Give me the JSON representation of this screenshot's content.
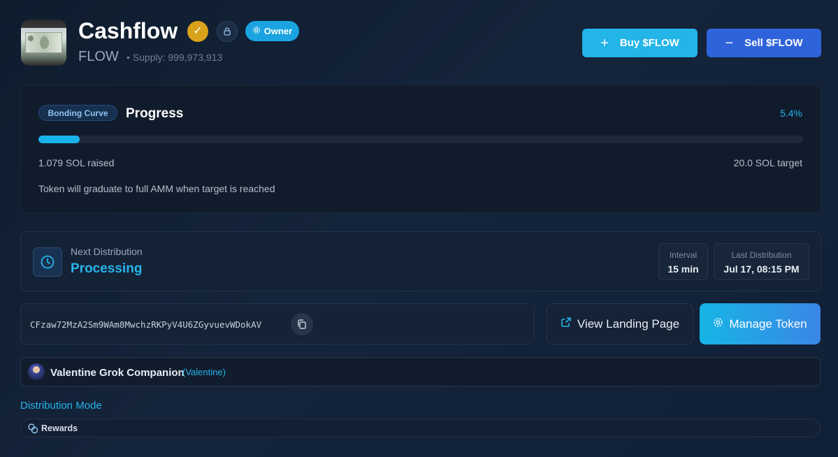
{
  "token": {
    "name": "Cashflow",
    "ticker": "FLOW",
    "supply": "• Supply: 999,973,913",
    "owner_badge": "Owner"
  },
  "actions": {
    "buy_label": "Buy $FLOW",
    "sell_label": "Sell $FLOW"
  },
  "progress": {
    "chip": "Bonding Curve",
    "title": "Progress",
    "percent_label": "5.4%",
    "percent_value": 5.4,
    "raised": "1.079 SOL raised",
    "target": "20.0 SOL target",
    "note": "Token will graduate to full AMM when target is reached"
  },
  "distribution": {
    "label": "Next Distribution",
    "status": "Processing",
    "interval_label": "Interval",
    "interval_value": "15 min",
    "last_label": "Last Distribution",
    "last_value": "Jul 17, 08:15 PM"
  },
  "contract": {
    "address": "CFzaw72MzA2Sm9WAm8MwchzRKPyV4U6ZGyvuevWDokAV"
  },
  "links": {
    "landing_label": "View Landing Page",
    "manage_label": "Manage Token"
  },
  "persona": {
    "name": "Valentine Grok Companion",
    "tag": "(Valentine)"
  },
  "distribution_mode": {
    "title": "Distribution Mode",
    "value": "Rewards"
  },
  "colors": {
    "accent": "#27b4ea",
    "buy": "#23b4e8",
    "sell": "#2f63db",
    "verified": "#d9a21b"
  }
}
